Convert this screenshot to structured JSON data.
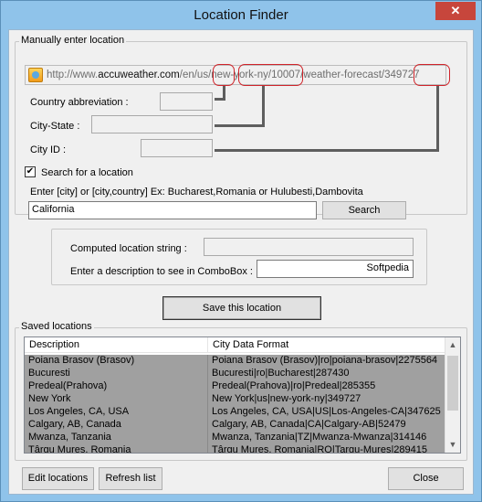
{
  "window": {
    "title": "Location Finder",
    "close_glyph": "✕"
  },
  "manual": {
    "legend": "Manually enter location",
    "url": {
      "prefix": "http://www.",
      "domain": "accuweather.com",
      "path": "/en/us/new-york-ny/10007/weather-forecast/349727"
    },
    "country_label": "Country abbreviation :",
    "city_state_label": "City-State :",
    "city_id_label": "City ID :",
    "country_value": "",
    "city_state_value": "",
    "city_id_value": ""
  },
  "search": {
    "checkbox_label": "Search for a location",
    "checked": true,
    "check_glyph": "✔",
    "hint": "Enter [city] or [city,country]    Ex: Bucharest,Romania or Hulubesti,Dambovita",
    "input_value": "California",
    "button_label": "Search"
  },
  "computed": {
    "label": "Computed location string :",
    "value": "",
    "desc_label": "Enter a description to see in ComboBox :",
    "desc_value": "Softpedia"
  },
  "save_button": "Save this location",
  "saved": {
    "legend": "Saved locations",
    "columns": [
      "Description",
      "City Data Format"
    ],
    "rows": [
      [
        "Poiana Brasov (Brasov)",
        "Poiana Brasov (Brasov)|ro|poiana-brasov|2275564"
      ],
      [
        "Bucuresti",
        "Bucuresti|ro|Bucharest|287430"
      ],
      [
        "Predeal(Prahova)",
        "Predeal(Prahova)|ro|Predeal|285355"
      ],
      [
        "New York",
        "New York|us|new-york-ny|349727"
      ],
      [
        "Los Angeles, CA, USA",
        "Los Angeles, CA, USA|US|Los-Angeles-CA|347625"
      ],
      [
        "Calgary, AB, Canada",
        "Calgary, AB, Canada|CA|Calgary-AB|52479"
      ],
      [
        "Mwanza, Tanzania",
        "Mwanza, Tanzania|TZ|Mwanza-Mwanza|314146"
      ],
      [
        "Târgu Mureș, Romania",
        "Târgu Mureș, Romania|RO|Targu-Mures|289415"
      ]
    ]
  },
  "footer": {
    "edit": "Edit locations",
    "refresh": "Refresh list",
    "close": "Close"
  }
}
